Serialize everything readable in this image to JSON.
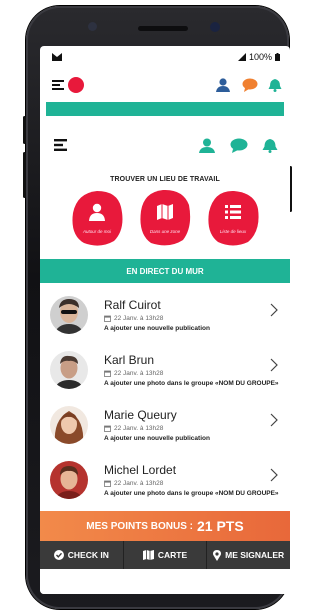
{
  "status": {
    "battery": "100%"
  },
  "search": {
    "title": "TROUVER UN LIEU DE TRAVAIL",
    "options": [
      {
        "label": "Autour de moi",
        "icon": "person-icon"
      },
      {
        "label": "Dans une zone",
        "icon": "map-icon"
      },
      {
        "label": "Liste de lieux",
        "icon": "list-icon"
      }
    ]
  },
  "wall": {
    "title": "EN DIRECT DU MUR"
  },
  "feed": [
    {
      "name": "Ralf Cuirot",
      "date": "22 Janv. à 13h28",
      "action": "A ajouter une nouvelle publication"
    },
    {
      "name": "Karl Brun",
      "date": "22 Janv. à 13h28",
      "action": "A ajouter une photo dans le groupe «NOM DU GROUPE»"
    },
    {
      "name": "Marie Queury",
      "date": "22 Janv. à 13h28",
      "action": "A ajouter une nouvelle publication"
    },
    {
      "name": "Michel Lordet",
      "date": "22 Janv. à 13h28",
      "action": "A ajouter une photo dans le groupe «NOM DU GROUPE»"
    }
  ],
  "bonus": {
    "label": "MES POINTS BONUS :",
    "value": "21 PTS"
  },
  "bottom_nav": [
    {
      "label": "CHECK IN",
      "icon": "check-circle-icon"
    },
    {
      "label": "CARTE",
      "icon": "map-icon"
    },
    {
      "label": "ME SIGNALER",
      "icon": "location-pin-icon"
    }
  ],
  "colors": {
    "teal": "#1fb396",
    "red": "#e8193b",
    "orange": "#f28a4a",
    "dark": "#3a3a3a",
    "person": "#1fb396",
    "chat": "#f08030",
    "bell": "#1fb396"
  }
}
